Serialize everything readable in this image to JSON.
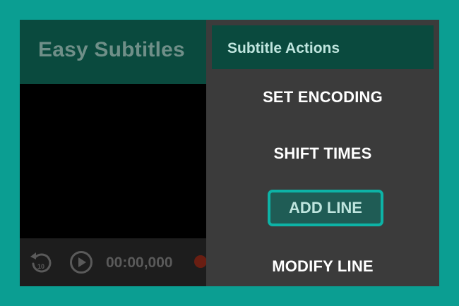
{
  "app": {
    "title": "Easy Subtitles"
  },
  "player": {
    "replay_icon": "replay-10-icon",
    "replay_badge": "10",
    "play_icon": "play-circle-icon",
    "time": "00:00,000"
  },
  "menu": {
    "header": "Subtitle Actions",
    "items": [
      {
        "label": "SET ENCODING",
        "selected": false
      },
      {
        "label": "SHIFT TIMES",
        "selected": false
      },
      {
        "label": "ADD LINE",
        "selected": true
      },
      {
        "label": "MODIFY LINE",
        "selected": false
      }
    ]
  },
  "colors": {
    "frame": "#0b9e92",
    "appbar": "#0a4a3e",
    "menu_background": "#3b3b3b",
    "selected_border": "#0db3a6",
    "selected_fill": "#1f5c55"
  }
}
